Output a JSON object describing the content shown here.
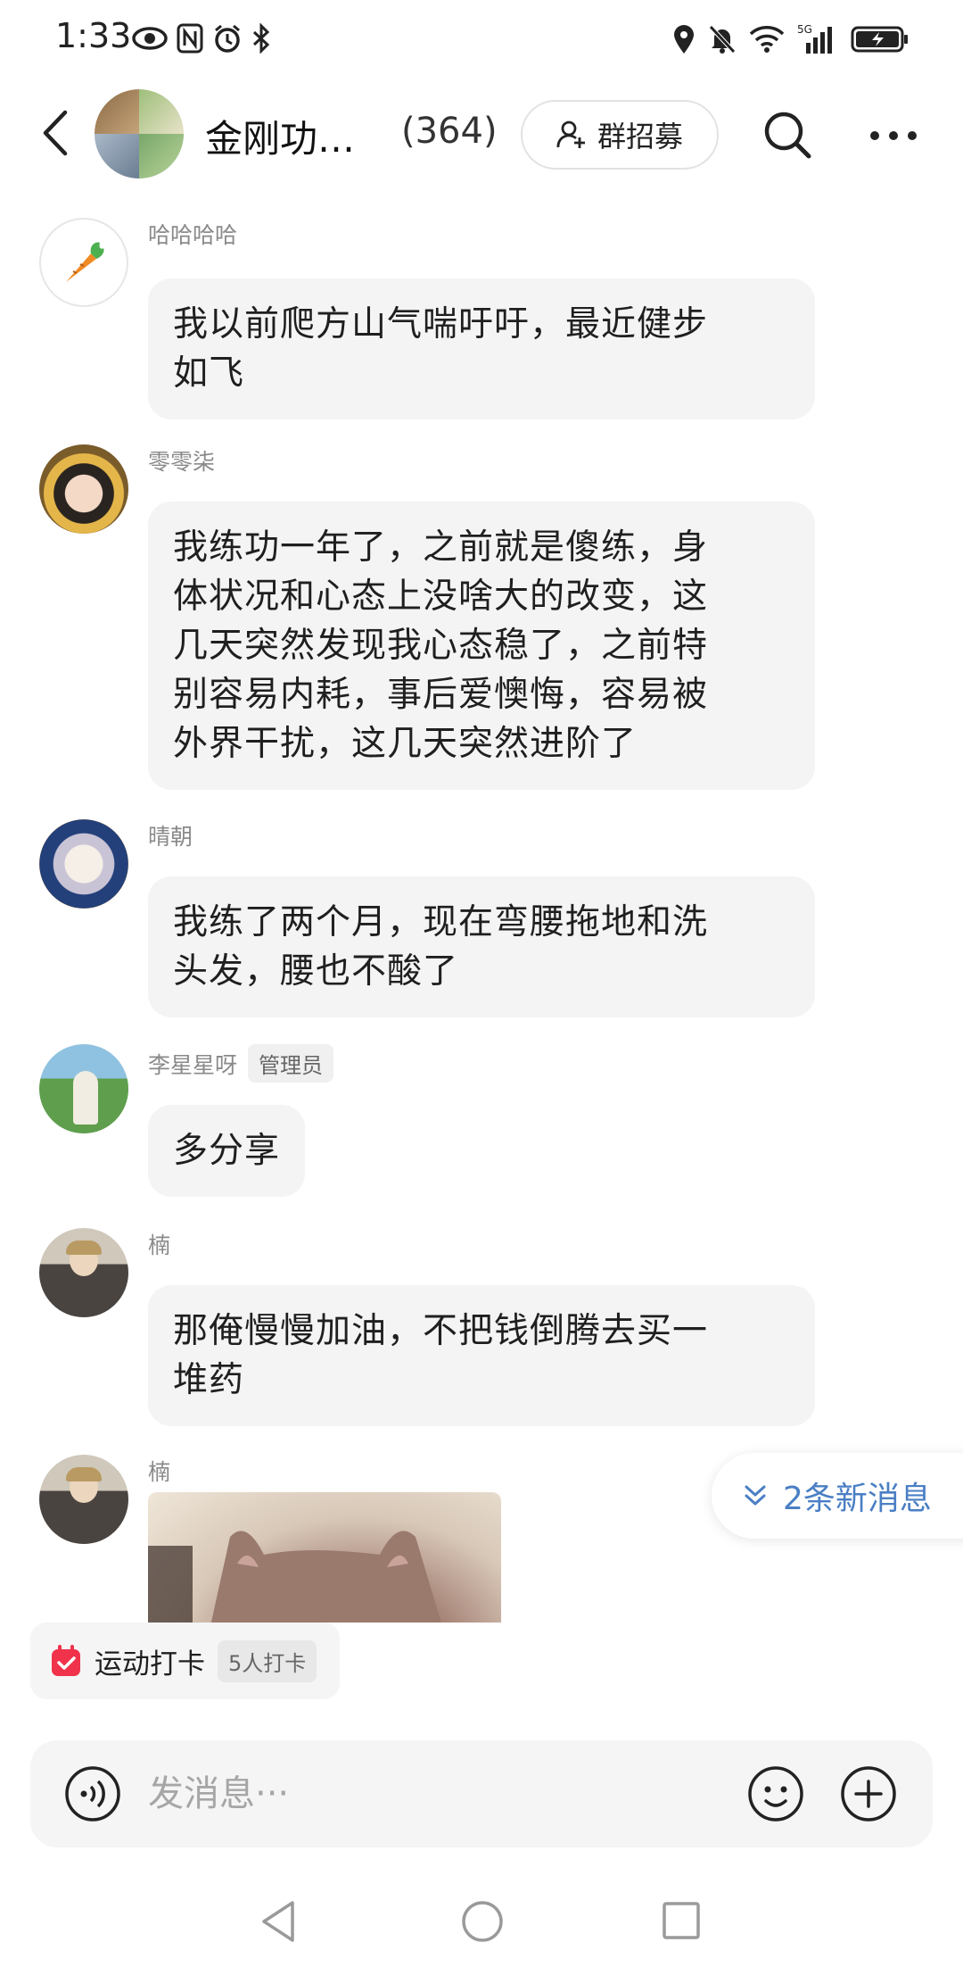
{
  "status_bar": {
    "time": "1:33",
    "network": "5G",
    "icons": [
      "eye-icon",
      "nfc-icon",
      "alarm-icon",
      "bluetooth-icon",
      "location-icon",
      "mute-icon",
      "wifi-icon",
      "signal-icon",
      "battery-icon"
    ]
  },
  "header": {
    "group_name": "金刚功…",
    "member_count": "(364)",
    "recruit_label": "群招募"
  },
  "messages": [
    {
      "sender": "哈哈哈哈",
      "text_lines": [
        "我以前爬方山气喘吁吁，最近健步",
        "如飞"
      ]
    },
    {
      "sender": "零零柒",
      "text_lines": [
        "我练功一年了，之前就是傻练，身",
        "体状况和心态上没啥大的改变，这",
        "几天突然发现我心态稳了，之前特",
        "别容易内耗，事后爱懊悔，容易被",
        "外界干扰，这几天突然进阶了"
      ]
    },
    {
      "sender": "晴朝",
      "text_lines": [
        "我练了两个月，现在弯腰拖地和洗",
        "头发，腰也不酸了"
      ]
    },
    {
      "sender": "李星星呀",
      "badge": "管理员",
      "text_lines": [
        "多分享"
      ]
    },
    {
      "sender": "楠",
      "text_lines": [
        "那俺慢慢加油，不把钱倒腾去买一",
        "堆药"
      ]
    },
    {
      "sender": "楠",
      "type": "image"
    }
  ],
  "new_messages_label": "2条新消息",
  "checkin": {
    "label": "运动打卡",
    "count": "5人打卡"
  },
  "input": {
    "placeholder": "发消息···"
  },
  "colors": {
    "accent_blue": "#4a7fc4",
    "bubble_bg": "#f4f4f4",
    "checkin_red": "#f0324a"
  }
}
